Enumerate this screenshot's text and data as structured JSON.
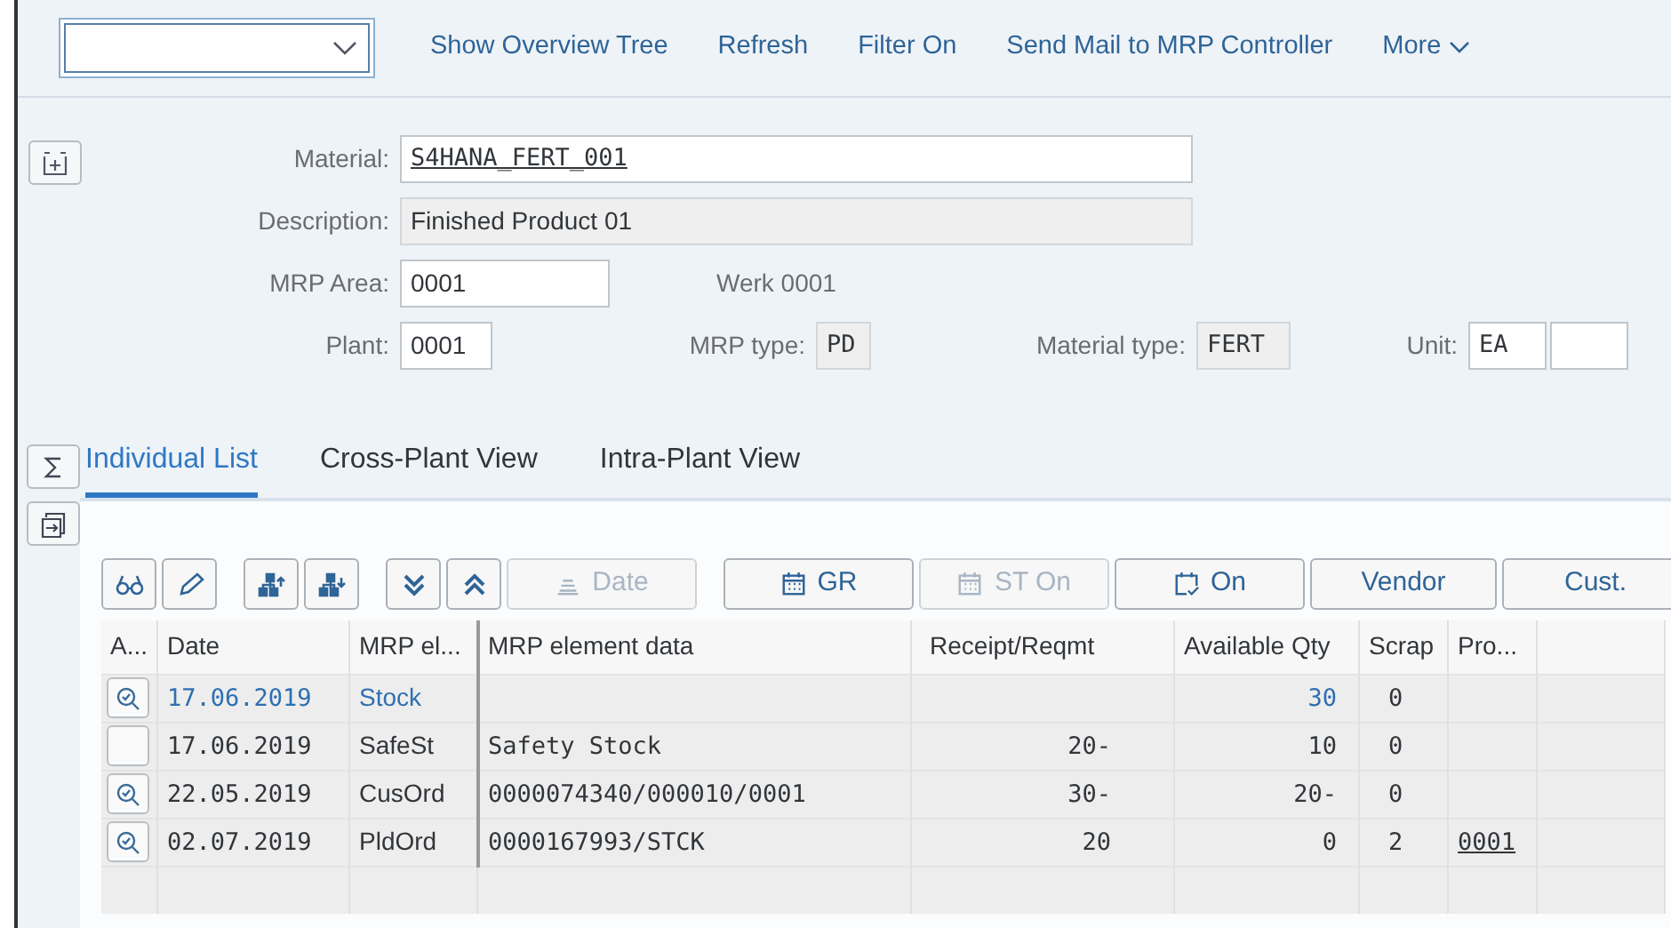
{
  "toolbar": {
    "actions": [
      "Show Overview Tree",
      "Refresh",
      "Filter On",
      "Send Mail to MRP Controller"
    ],
    "more": "More"
  },
  "header": {
    "material_label": "Material:",
    "material": "S4HANA_FERT_001",
    "description_label": "Description:",
    "description": "Finished Product 01",
    "mrp_area_label": "MRP Area:",
    "mrp_area": "0001",
    "mrp_area_text": "Werk 0001",
    "plant_label": "Plant:",
    "plant": "0001",
    "mrp_type_label": "MRP type:",
    "mrp_type": "PD",
    "material_type_label": "Material type:",
    "material_type": "FERT",
    "unit_label": "Unit:",
    "unit": "EA"
  },
  "tabs": [
    {
      "label": "Individual List",
      "selected": true
    },
    {
      "label": "Cross-Plant View",
      "selected": false
    },
    {
      "label": "Intra-Plant View",
      "selected": false
    }
  ],
  "grid_toolbar": [
    {
      "kind": "icon",
      "disabled": false
    },
    {
      "kind": "icon",
      "disabled": false
    },
    {
      "kind": "icon",
      "disabled": false
    },
    {
      "kind": "icon",
      "disabled": false
    },
    {
      "kind": "icon",
      "disabled": false
    },
    {
      "kind": "icon",
      "disabled": false
    },
    {
      "kind": "text",
      "label": "Date",
      "disabled": true
    },
    {
      "kind": "text",
      "label": "GR",
      "disabled": false
    },
    {
      "kind": "text",
      "label": "ST On",
      "disabled": true
    },
    {
      "kind": "text",
      "label": "On",
      "disabled": false
    },
    {
      "kind": "text",
      "label": "Vendor",
      "disabled": false
    },
    {
      "kind": "text",
      "label": "Cust.",
      "disabled": false
    }
  ],
  "table": {
    "columns": [
      "A...",
      "Date",
      "MRP el...",
      "MRP element data",
      "Receipt/Reqmt",
      "Available Qty",
      "Scrap",
      "Pro..."
    ],
    "rows": [
      {
        "detail": true,
        "highlighted": true,
        "cells": [
          "",
          "17.06.2019",
          "Stock",
          "",
          "",
          "30",
          "0",
          ""
        ]
      },
      {
        "detail": false,
        "highlighted": false,
        "cells": [
          "",
          "17.06.2019",
          "SafeSt",
          "Safety Stock",
          "20-",
          "10",
          "0",
          ""
        ]
      },
      {
        "detail": true,
        "highlighted": false,
        "cells": [
          "",
          "22.05.2019",
          "CusOrd",
          "0000074340/000010/0001",
          "30-",
          "20-",
          "0",
          ""
        ]
      },
      {
        "detail": true,
        "highlighted": false,
        "cells": [
          "",
          "02.07.2019",
          "PldOrd",
          "0000167993/STCK",
          "20",
          "0",
          "2",
          "0001"
        ]
      }
    ]
  }
}
